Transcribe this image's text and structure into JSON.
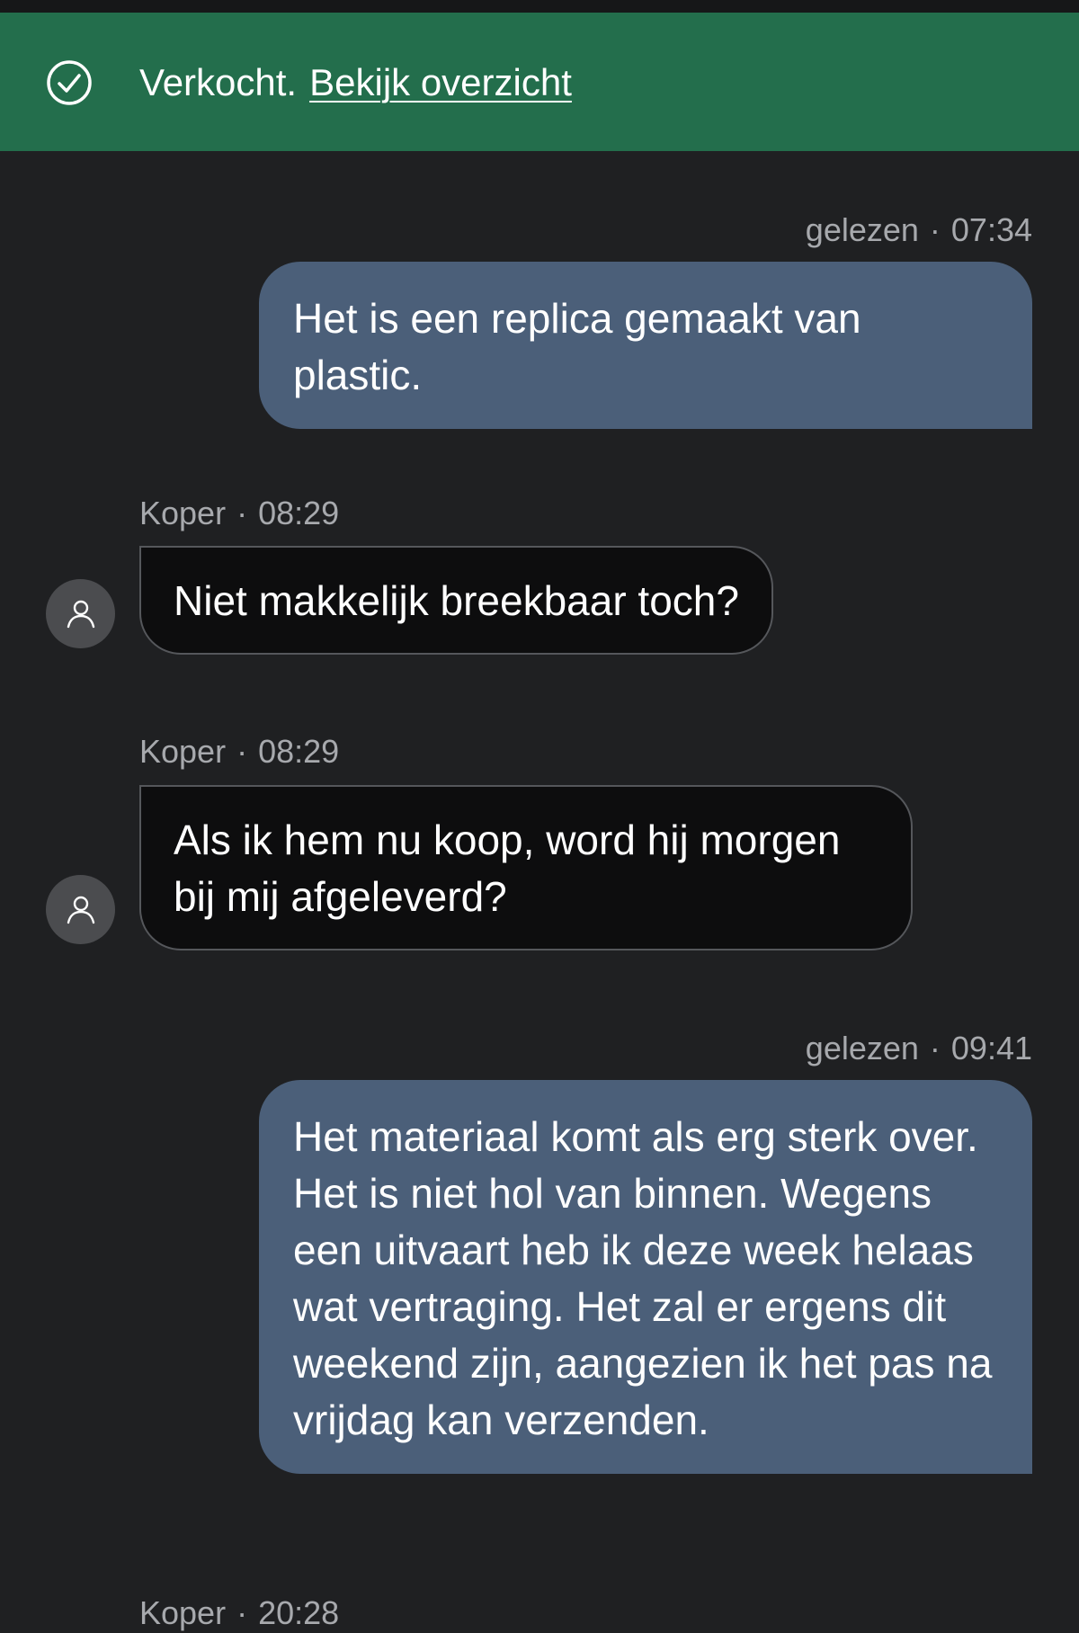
{
  "banner": {
    "status_text": "Verkocht.",
    "link_text": "Bekijk overzicht",
    "icon": "check-circle-icon",
    "color": "#236e4c"
  },
  "messages": [
    {
      "direction": "outgoing",
      "status": "gelezen",
      "time": "07:34",
      "text": "Het is een replica gemaakt van plastic."
    },
    {
      "direction": "incoming",
      "sender": "Koper",
      "time": "08:29",
      "text": "Niet makkelijk breekbaar toch?"
    },
    {
      "direction": "incoming",
      "sender": "Koper",
      "time": "08:29",
      "text": "Als ik hem nu koop, word hij morgen bij mij afgeleverd?"
    },
    {
      "direction": "outgoing",
      "status": "gelezen",
      "time": "09:41",
      "text": "Het materiaal komt als erg sterk over. Het is niet hol van binnen. Wegens een uitvaart heb ik deze week helaas wat vertraging. Het zal er ergens dit weekend zijn, aangezien ik het pas na vrijdag kan verzenden."
    },
    {
      "direction": "incoming",
      "sender": "Koper",
      "time": "20:28"
    }
  ],
  "separator": "·",
  "colors": {
    "background": "#1f2022",
    "outgoing_bubble": "#4b5f79",
    "incoming_bubble": "#0d0d0e"
  }
}
